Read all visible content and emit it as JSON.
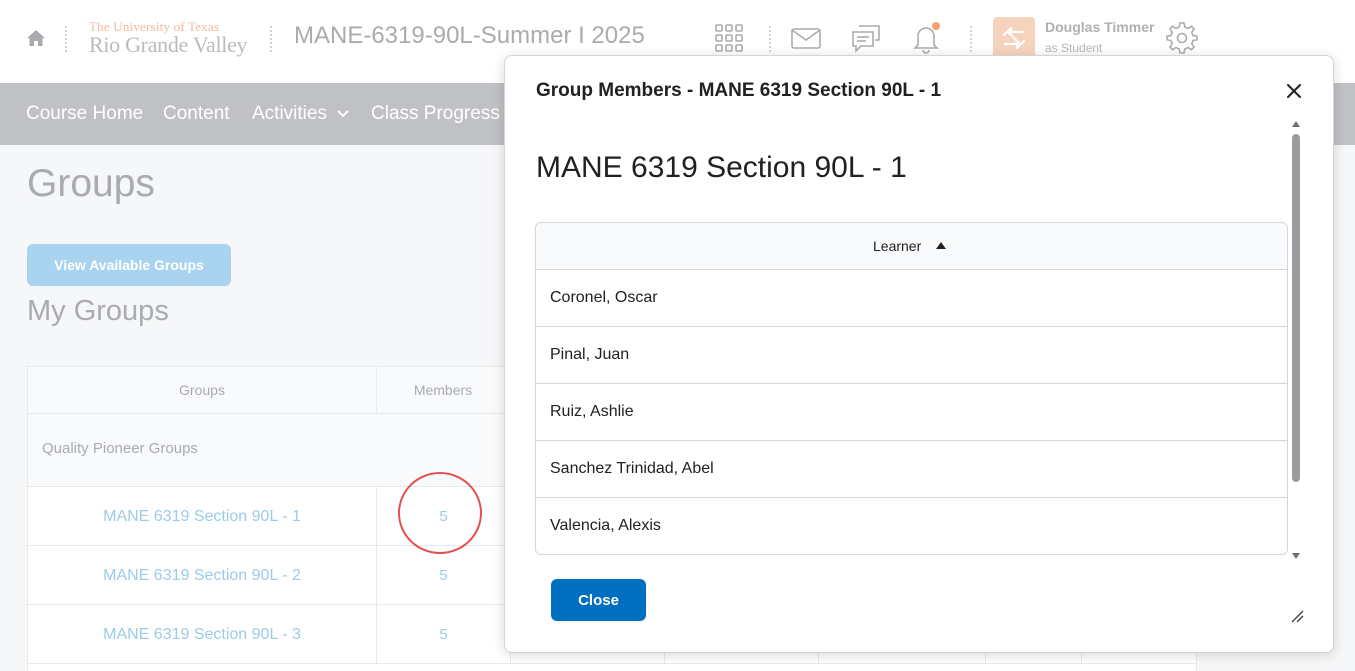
{
  "header": {
    "logo_top": "The University of Texas",
    "logo_bottom": "Rio Grande Valley",
    "course_title": "MANE-6319-90L-Summer I 2025",
    "user_name": "Douglas Timmer",
    "user_role": "as Student",
    "icons": [
      "home-icon",
      "waffle-grid-icon",
      "mail-icon",
      "chat-icon",
      "bell-icon",
      "role-switch-icon",
      "gear-icon"
    ],
    "notification_dot_color": "#f3a26e"
  },
  "nav": {
    "items": [
      {
        "label": "Course Home"
      },
      {
        "label": "Content"
      },
      {
        "label": "Activities"
      },
      {
        "label": "Class Progress"
      }
    ]
  },
  "page": {
    "title": "Groups",
    "view_button": "View Available Groups",
    "section_title": "My Groups",
    "table": {
      "col_groups": "Groups",
      "col_members": "Members",
      "category": "Quality Pioneer Groups",
      "rows": [
        {
          "name": "MANE 6319 Section 90L - 1",
          "members": "5"
        },
        {
          "name": "MANE 6319 Section 90L - 2",
          "members": "5"
        },
        {
          "name": "MANE 6319 Section 90L - 3",
          "members": "5"
        }
      ]
    }
  },
  "dialog": {
    "title": "Group Members - MANE 6319 Section 90L - 1",
    "heading": "MANE 6319 Section 90L - 1",
    "column": "Learner",
    "learners": [
      "Coronel, Oscar",
      "Pinal, Juan",
      "Ruiz, Ashlie",
      "Sanchez Trinidad, Abel",
      "Valencia, Alexis"
    ],
    "close_button": "Close"
  },
  "colors": {
    "primary_button": "#006fbf",
    "annotation_circle": "#e05252",
    "link": "#9ccbe6"
  }
}
